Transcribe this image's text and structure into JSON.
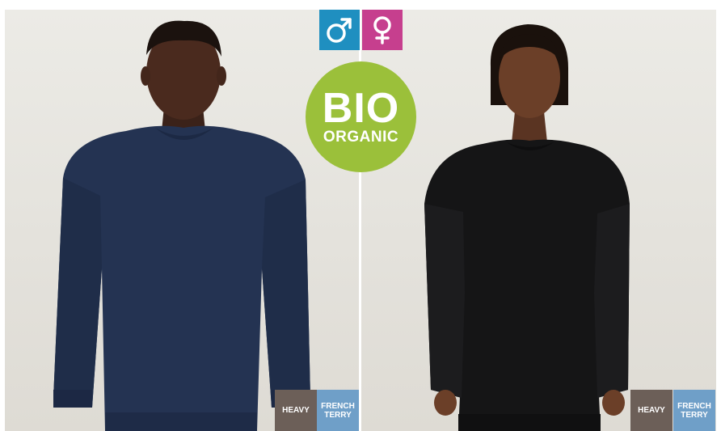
{
  "gender_icons": [
    {
      "name": "male-symbol-icon",
      "color": "#1f8fc0"
    },
    {
      "name": "female-symbol-icon",
      "color": "#c63f8e"
    }
  ],
  "badge": {
    "main": "BIO",
    "sub": "ORGANIC",
    "color": "#9bc03a"
  },
  "left_panel": {
    "model": "male model in navy crewneck sweatshirt",
    "garment_color": "#243352",
    "tags": [
      {
        "label": "HEAVY",
        "color": "#6c5f58"
      },
      {
        "label": "FRENCH\nTERRY",
        "color": "#6f9fc8"
      }
    ]
  },
  "right_panel": {
    "model": "female model in black oversized sweatshirt",
    "garment_color": "#151516",
    "tags": [
      {
        "label": "HEAVY",
        "color": "#6c5f58"
      },
      {
        "label": "FRENCH\nTERRY",
        "color": "#6f9fc8"
      }
    ]
  }
}
